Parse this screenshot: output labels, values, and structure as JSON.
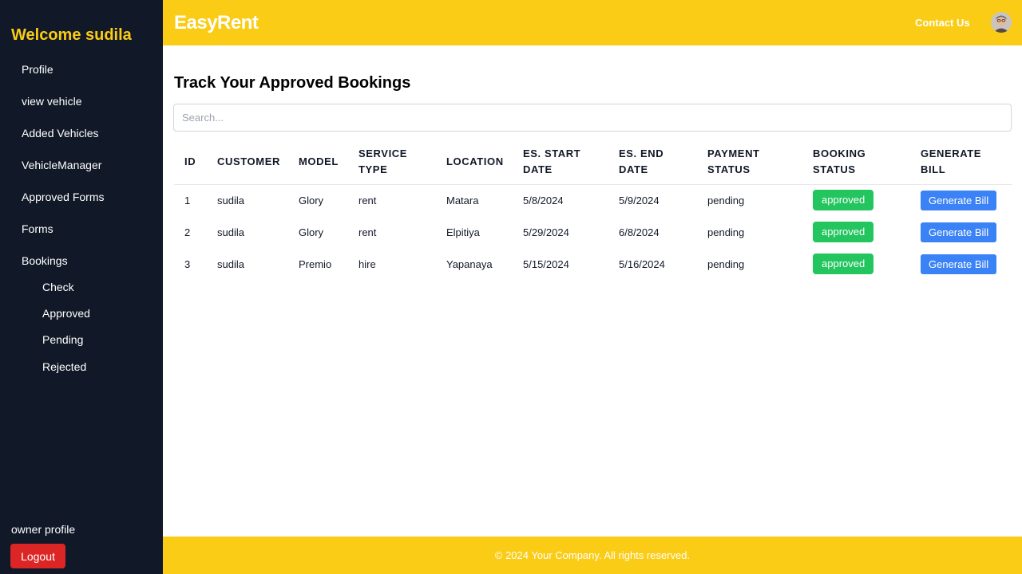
{
  "sidebar": {
    "welcome": "Welcome sudila",
    "items": [
      {
        "label": "Profile"
      },
      {
        "label": "view vehicle"
      },
      {
        "label": "Added Vehicles"
      },
      {
        "label": "VehicleManager"
      },
      {
        "label": "Approved Forms"
      },
      {
        "label": "Forms"
      },
      {
        "label": "Bookings"
      }
    ],
    "sub_items": [
      {
        "label": "Check"
      },
      {
        "label": "Approved"
      },
      {
        "label": "Pending"
      },
      {
        "label": "Rejected"
      }
    ],
    "owner_profile": "owner profile",
    "logout": "Logout"
  },
  "header": {
    "brand": "EasyRent",
    "contact": "Contact Us",
    "avatar_icon": "user-avatar-icon"
  },
  "main": {
    "title": "Track Your Approved Bookings",
    "search_placeholder": "Search...",
    "columns": [
      "ID",
      "CUSTOMER",
      "MODEL",
      "SERVICE TYPE",
      "LOCATION",
      "ES. START DATE",
      "ES. END DATE",
      "PAYMENT STATUS",
      "BOOKING STATUS",
      "GENERATE BILL"
    ],
    "rows": [
      {
        "id": "1",
        "customer": "sudila",
        "model": "Glory",
        "service_type": "rent",
        "location": "Matara",
        "start": "5/8/2024",
        "end": "5/9/2024",
        "payment": "pending",
        "status": "approved",
        "action": "Generate Bill"
      },
      {
        "id": "2",
        "customer": "sudila",
        "model": "Glory",
        "service_type": "rent",
        "location": "Elpitiya",
        "start": "5/29/2024",
        "end": "6/8/2024",
        "payment": "pending",
        "status": "approved",
        "action": "Generate Bill"
      },
      {
        "id": "3",
        "customer": "sudila",
        "model": "Premio",
        "service_type": "hire",
        "location": "Yapanaya",
        "start": "5/15/2024",
        "end": "5/16/2024",
        "payment": "pending",
        "status": "approved",
        "action": "Generate Bill"
      }
    ]
  },
  "footer": {
    "text": "© 2024 Your Company. All rights reserved."
  },
  "colors": {
    "sidebar_bg": "#111827",
    "accent_yellow": "#facc15",
    "approved_green": "#22c55e",
    "bill_blue": "#3b82f6",
    "logout_red": "#dc2626"
  }
}
